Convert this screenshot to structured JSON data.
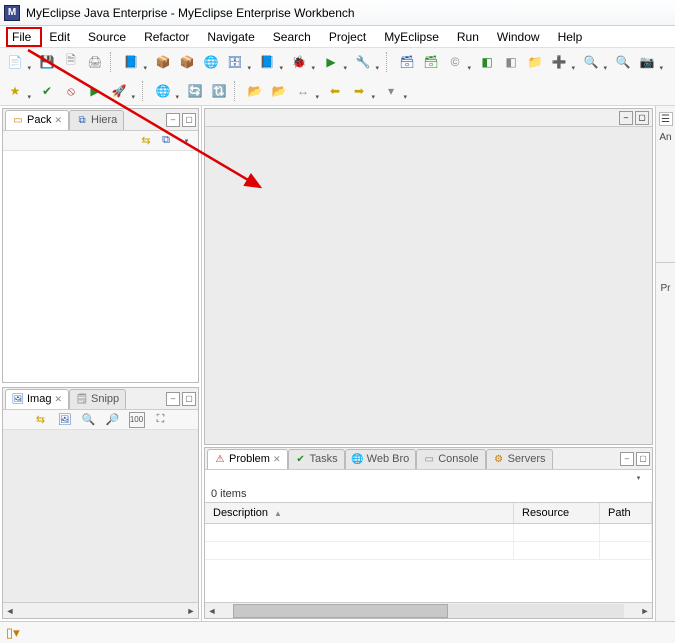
{
  "title": "MyEclipse Java Enterprise - MyEclipse Enterprise Workbench",
  "menu": [
    "File",
    "Edit",
    "Source",
    "Refactor",
    "Navigate",
    "Search",
    "Project",
    "MyEclipse",
    "Run",
    "Window",
    "Help"
  ],
  "left": {
    "pack": {
      "tab1": "Pack",
      "tab2": "Hiera"
    },
    "img": {
      "tab1": "Imag",
      "tab2": "Snipp"
    }
  },
  "bottom": {
    "tabs": [
      "Problem",
      "Tasks",
      "Web Bro",
      "Console",
      "Servers"
    ],
    "items_label": "0 items",
    "columns": [
      "Description",
      "Resource",
      "Path"
    ]
  },
  "right_labels": {
    "an": "An",
    "pr": "Pr"
  },
  "status": ""
}
